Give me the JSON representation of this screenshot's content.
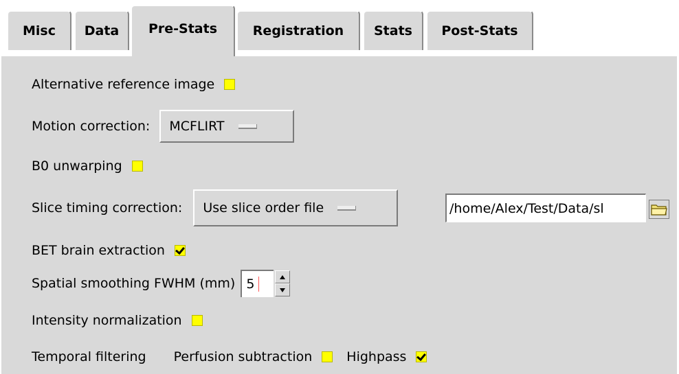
{
  "tabs": [
    {
      "label": "Misc"
    },
    {
      "label": "Data"
    },
    {
      "label": "Pre-Stats"
    },
    {
      "label": "Registration"
    },
    {
      "label": "Stats"
    },
    {
      "label": "Post-Stats"
    }
  ],
  "active_tab": "Pre-Stats",
  "alt_ref": {
    "label": "Alternative reference image",
    "checked": false
  },
  "motion": {
    "label": "Motion correction:",
    "value": "MCFLIRT"
  },
  "b0": {
    "label": "B0 unwarping",
    "checked": false
  },
  "slice_timing": {
    "label": "Slice timing correction:",
    "value": "Use slice order file",
    "file_path": "/home/Alex/Test/Data/sl"
  },
  "bet": {
    "label": "BET brain extraction",
    "checked": true
  },
  "smoothing": {
    "label": "Spatial smoothing FWHM (mm)",
    "value": "5"
  },
  "intensity": {
    "label": "Intensity normalization",
    "checked": false
  },
  "temporal": {
    "label": "Temporal filtering",
    "perfusion_label": "Perfusion subtraction",
    "perfusion_checked": false,
    "highpass_label": "Highpass",
    "highpass_checked": true
  },
  "colors": {
    "panel": "#d9d9d9",
    "checkbox": "#ffff00",
    "field": "#ffffff"
  }
}
